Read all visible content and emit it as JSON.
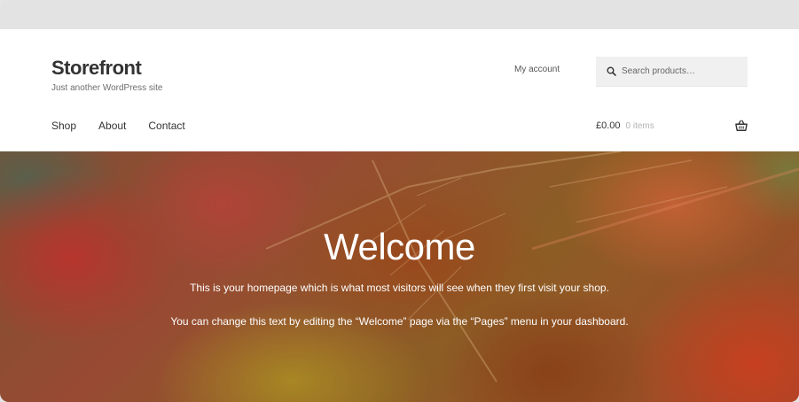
{
  "site": {
    "title": "Storefront",
    "tagline": "Just another WordPress site"
  },
  "header": {
    "account_label": "My account",
    "search_placeholder": "Search products…"
  },
  "nav": {
    "items": [
      {
        "label": "Shop"
      },
      {
        "label": "About"
      },
      {
        "label": "Contact"
      }
    ]
  },
  "cart": {
    "amount": "£0.00",
    "count": "0 items"
  },
  "hero": {
    "title": "Welcome",
    "text_1": "This is your homepage which is what most visitors will see when they first visit your shop.",
    "text_2": "You can change this text by editing the “Welcome” page via the “Pages” menu in your dashboard."
  },
  "colors": {
    "chrome": "#e3e3e3",
    "header_bg": "#ffffff",
    "text": "#333333",
    "muted": "#6d6d6d",
    "search_bg": "#f0f0f0"
  },
  "icons": {
    "search": "search-icon",
    "cart": "basket-icon"
  }
}
